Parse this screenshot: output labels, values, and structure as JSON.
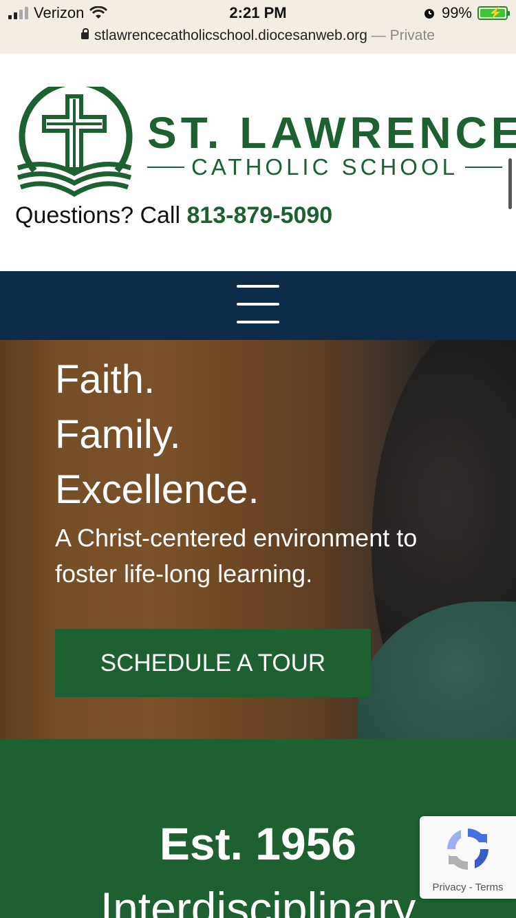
{
  "status_bar": {
    "carrier": "Verizon",
    "time": "2:21 PM",
    "battery": "99%",
    "url": "stlawrencecatholicschool.diocesanweb.org",
    "private_label": "— Private"
  },
  "header": {
    "name_line1": "ST. LAWRENCE",
    "name_line2": "CATHOLIC SCHOOL",
    "questions_text": "Questions? Call",
    "phone": "813-879-5090",
    "emblem_icon": "cross-book-emblem-icon"
  },
  "nav": {
    "menu_icon": "hamburger-menu-icon"
  },
  "hero": {
    "line1": "Faith.",
    "line2": "Family.",
    "line3": "Excellence.",
    "tagline": "A Christ-centered environment to foster life-long learning.",
    "cta": "SCHEDULE A TOUR"
  },
  "about": {
    "established": "Est. 1956",
    "subtitle_partial": "Interdisciplinary"
  },
  "recaptcha": {
    "privacy": "Privacy",
    "separator": " - ",
    "terms": "Terms"
  },
  "colors": {
    "brand_green": "#1d6132",
    "nav_navy": "#0c2c48"
  }
}
